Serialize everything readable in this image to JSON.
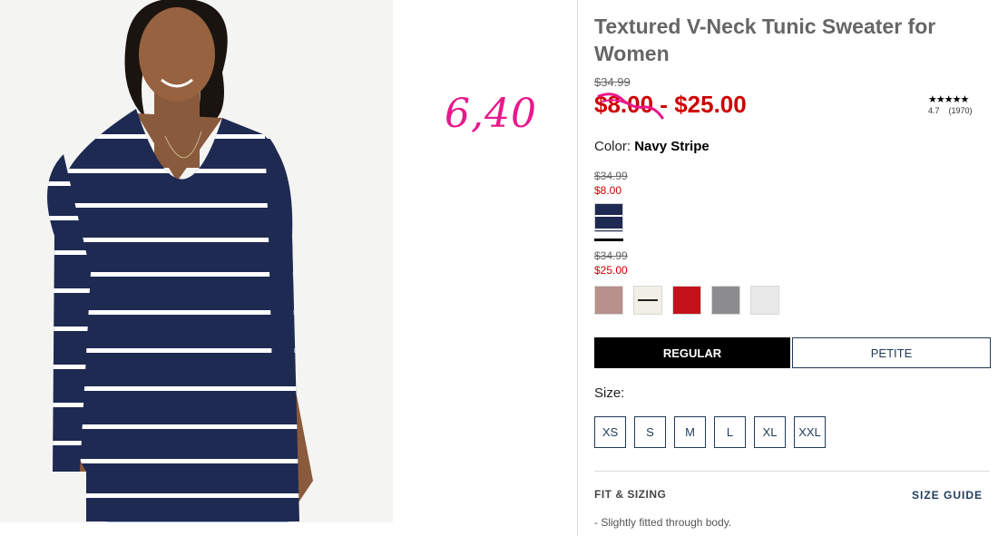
{
  "product": {
    "title": "Textured V-Neck Tunic Sweater for Women",
    "original_price": "$34.99",
    "sale_range_low": "$8.00",
    "sale_range_sep": " - ",
    "sale_range_high": "$25.00",
    "rating": {
      "stars": "★★★★★",
      "value": "4.7",
      "count": "(1970)"
    }
  },
  "annotation": "6,40",
  "color": {
    "label": "Color:",
    "selected": "Navy Stripe"
  },
  "price_tiers": [
    {
      "was": "$34.99",
      "now": "$8.00"
    },
    {
      "was": "$34.99",
      "now": "$25.00"
    }
  ],
  "swatches": {
    "primary": {
      "name": "Navy Stripe",
      "color": "#1e2a52"
    },
    "others": [
      {
        "name": "blush-heather-swatch",
        "color": "#b8908c"
      },
      {
        "name": "cream-stripe-swatch",
        "color": "#f2efe6"
      },
      {
        "name": "red-swatch",
        "color": "#c4121a"
      },
      {
        "name": "grey-heather-swatch",
        "color": "#8d8d8f"
      },
      {
        "name": "light-grey-swatch",
        "color": "#e9e9e9"
      }
    ]
  },
  "fit_tabs": {
    "regular": "REGULAR",
    "petite": "PETITE"
  },
  "size": {
    "label": "Size:",
    "options": [
      "XS",
      "S",
      "M",
      "L",
      "XL",
      "XXL"
    ]
  },
  "fit_sizing": {
    "heading": "FIT & SIZING",
    "guide_link": "SIZE GUIDE",
    "note": "Slightly fitted through body."
  },
  "colors": {
    "sale_red": "#cc0000",
    "annotation_pink": "#e8188c",
    "navy": "#1f3b5a"
  }
}
